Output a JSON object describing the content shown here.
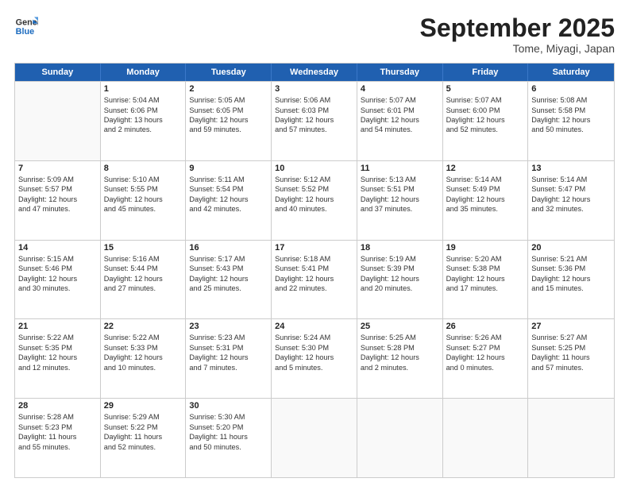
{
  "header": {
    "logo_line1": "General",
    "logo_line2": "Blue",
    "month": "September 2025",
    "location": "Tome, Miyagi, Japan"
  },
  "weekdays": [
    "Sunday",
    "Monday",
    "Tuesday",
    "Wednesday",
    "Thursday",
    "Friday",
    "Saturday"
  ],
  "rows": [
    [
      {
        "day": "",
        "lines": []
      },
      {
        "day": "1",
        "lines": [
          "Sunrise: 5:04 AM",
          "Sunset: 6:06 PM",
          "Daylight: 13 hours",
          "and 2 minutes."
        ]
      },
      {
        "day": "2",
        "lines": [
          "Sunrise: 5:05 AM",
          "Sunset: 6:05 PM",
          "Daylight: 12 hours",
          "and 59 minutes."
        ]
      },
      {
        "day": "3",
        "lines": [
          "Sunrise: 5:06 AM",
          "Sunset: 6:03 PM",
          "Daylight: 12 hours",
          "and 57 minutes."
        ]
      },
      {
        "day": "4",
        "lines": [
          "Sunrise: 5:07 AM",
          "Sunset: 6:01 PM",
          "Daylight: 12 hours",
          "and 54 minutes."
        ]
      },
      {
        "day": "5",
        "lines": [
          "Sunrise: 5:07 AM",
          "Sunset: 6:00 PM",
          "Daylight: 12 hours",
          "and 52 minutes."
        ]
      },
      {
        "day": "6",
        "lines": [
          "Sunrise: 5:08 AM",
          "Sunset: 5:58 PM",
          "Daylight: 12 hours",
          "and 50 minutes."
        ]
      }
    ],
    [
      {
        "day": "7",
        "lines": [
          "Sunrise: 5:09 AM",
          "Sunset: 5:57 PM",
          "Daylight: 12 hours",
          "and 47 minutes."
        ]
      },
      {
        "day": "8",
        "lines": [
          "Sunrise: 5:10 AM",
          "Sunset: 5:55 PM",
          "Daylight: 12 hours",
          "and 45 minutes."
        ]
      },
      {
        "day": "9",
        "lines": [
          "Sunrise: 5:11 AM",
          "Sunset: 5:54 PM",
          "Daylight: 12 hours",
          "and 42 minutes."
        ]
      },
      {
        "day": "10",
        "lines": [
          "Sunrise: 5:12 AM",
          "Sunset: 5:52 PM",
          "Daylight: 12 hours",
          "and 40 minutes."
        ]
      },
      {
        "day": "11",
        "lines": [
          "Sunrise: 5:13 AM",
          "Sunset: 5:51 PM",
          "Daylight: 12 hours",
          "and 37 minutes."
        ]
      },
      {
        "day": "12",
        "lines": [
          "Sunrise: 5:14 AM",
          "Sunset: 5:49 PM",
          "Daylight: 12 hours",
          "and 35 minutes."
        ]
      },
      {
        "day": "13",
        "lines": [
          "Sunrise: 5:14 AM",
          "Sunset: 5:47 PM",
          "Daylight: 12 hours",
          "and 32 minutes."
        ]
      }
    ],
    [
      {
        "day": "14",
        "lines": [
          "Sunrise: 5:15 AM",
          "Sunset: 5:46 PM",
          "Daylight: 12 hours",
          "and 30 minutes."
        ]
      },
      {
        "day": "15",
        "lines": [
          "Sunrise: 5:16 AM",
          "Sunset: 5:44 PM",
          "Daylight: 12 hours",
          "and 27 minutes."
        ]
      },
      {
        "day": "16",
        "lines": [
          "Sunrise: 5:17 AM",
          "Sunset: 5:43 PM",
          "Daylight: 12 hours",
          "and 25 minutes."
        ]
      },
      {
        "day": "17",
        "lines": [
          "Sunrise: 5:18 AM",
          "Sunset: 5:41 PM",
          "Daylight: 12 hours",
          "and 22 minutes."
        ]
      },
      {
        "day": "18",
        "lines": [
          "Sunrise: 5:19 AM",
          "Sunset: 5:39 PM",
          "Daylight: 12 hours",
          "and 20 minutes."
        ]
      },
      {
        "day": "19",
        "lines": [
          "Sunrise: 5:20 AM",
          "Sunset: 5:38 PM",
          "Daylight: 12 hours",
          "and 17 minutes."
        ]
      },
      {
        "day": "20",
        "lines": [
          "Sunrise: 5:21 AM",
          "Sunset: 5:36 PM",
          "Daylight: 12 hours",
          "and 15 minutes."
        ]
      }
    ],
    [
      {
        "day": "21",
        "lines": [
          "Sunrise: 5:22 AM",
          "Sunset: 5:35 PM",
          "Daylight: 12 hours",
          "and 12 minutes."
        ]
      },
      {
        "day": "22",
        "lines": [
          "Sunrise: 5:22 AM",
          "Sunset: 5:33 PM",
          "Daylight: 12 hours",
          "and 10 minutes."
        ]
      },
      {
        "day": "23",
        "lines": [
          "Sunrise: 5:23 AM",
          "Sunset: 5:31 PM",
          "Daylight: 12 hours",
          "and 7 minutes."
        ]
      },
      {
        "day": "24",
        "lines": [
          "Sunrise: 5:24 AM",
          "Sunset: 5:30 PM",
          "Daylight: 12 hours",
          "and 5 minutes."
        ]
      },
      {
        "day": "25",
        "lines": [
          "Sunrise: 5:25 AM",
          "Sunset: 5:28 PM",
          "Daylight: 12 hours",
          "and 2 minutes."
        ]
      },
      {
        "day": "26",
        "lines": [
          "Sunrise: 5:26 AM",
          "Sunset: 5:27 PM",
          "Daylight: 12 hours",
          "and 0 minutes."
        ]
      },
      {
        "day": "27",
        "lines": [
          "Sunrise: 5:27 AM",
          "Sunset: 5:25 PM",
          "Daylight: 11 hours",
          "and 57 minutes."
        ]
      }
    ],
    [
      {
        "day": "28",
        "lines": [
          "Sunrise: 5:28 AM",
          "Sunset: 5:23 PM",
          "Daylight: 11 hours",
          "and 55 minutes."
        ]
      },
      {
        "day": "29",
        "lines": [
          "Sunrise: 5:29 AM",
          "Sunset: 5:22 PM",
          "Daylight: 11 hours",
          "and 52 minutes."
        ]
      },
      {
        "day": "30",
        "lines": [
          "Sunrise: 5:30 AM",
          "Sunset: 5:20 PM",
          "Daylight: 11 hours",
          "and 50 minutes."
        ]
      },
      {
        "day": "",
        "lines": []
      },
      {
        "day": "",
        "lines": []
      },
      {
        "day": "",
        "lines": []
      },
      {
        "day": "",
        "lines": []
      }
    ]
  ]
}
